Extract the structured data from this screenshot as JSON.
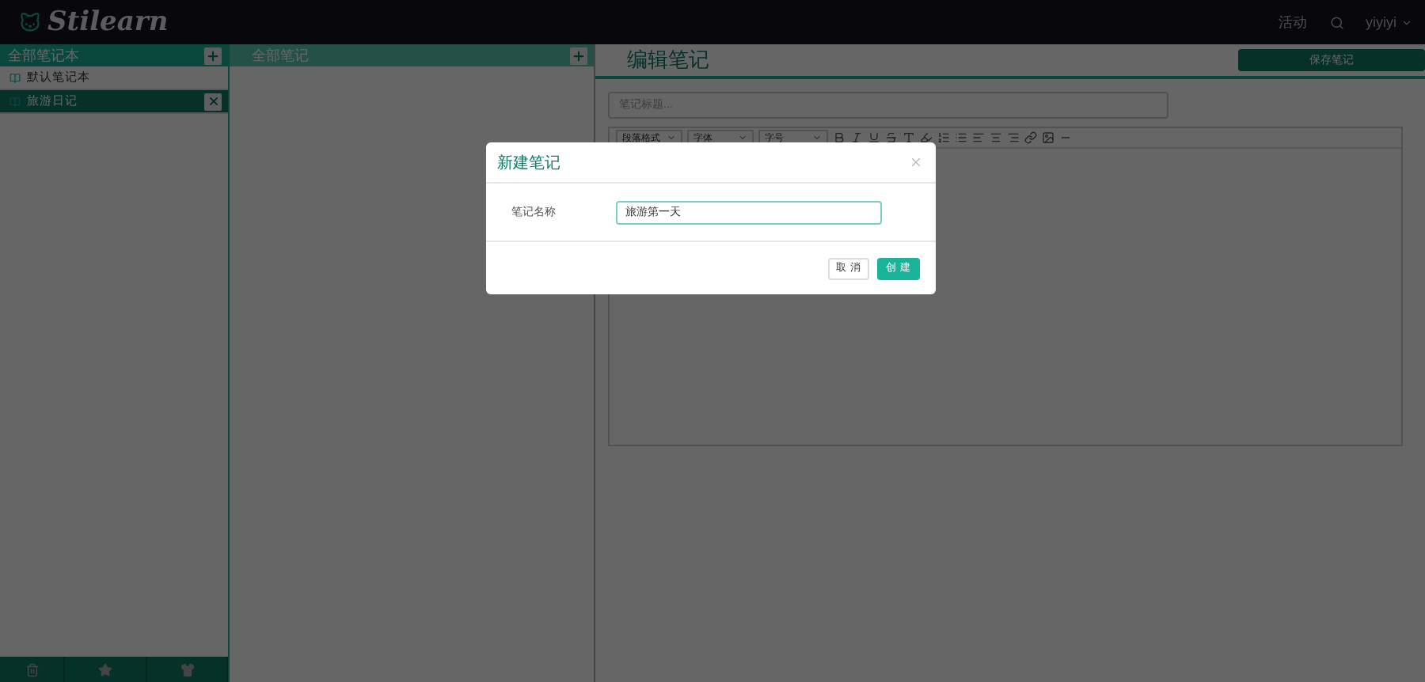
{
  "topbar": {
    "logo": "Stilearn",
    "links": [
      "活动"
    ],
    "user": "yiyiyi"
  },
  "notebooks": {
    "title": "全部笔记本",
    "items": [
      {
        "label": "默认笔记本",
        "selected": false
      },
      {
        "label": "旅游日记",
        "selected": true
      }
    ]
  },
  "notes": {
    "title": "全部笔记"
  },
  "editor": {
    "title": "编辑笔记",
    "save": "保存笔记",
    "title_field": {
      "placeholder": "笔记标题..."
    },
    "dropdowns": [
      "段落格式",
      "字体",
      "字号"
    ]
  },
  "dialog": {
    "title": "新建笔记",
    "field_label": "笔记名称",
    "field_value": "旅游第一天",
    "buttons": [
      {
        "label": "取 消",
        "kind": "default"
      },
      {
        "label": "创 建",
        "kind": "primary"
      }
    ]
  }
}
